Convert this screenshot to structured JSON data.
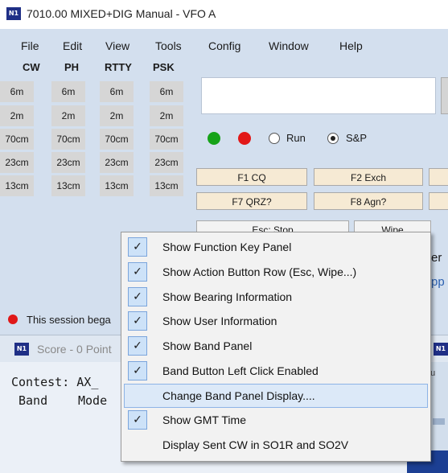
{
  "window": {
    "icon_text": "N1",
    "title": "7010.00 MIXED+DIG Manual - VFO A"
  },
  "menubar": [
    "File",
    "Edit",
    "View",
    "Tools",
    "Config",
    "Window",
    "Help"
  ],
  "modes": [
    "CW",
    "PH",
    "RTTY",
    "PSK"
  ],
  "bands": [
    "6m",
    "2m",
    "70cm",
    "23cm",
    "13cm"
  ],
  "status": {
    "led1_color": "#16a319",
    "led2_color": "#e21818",
    "run_label": "Run",
    "sp_label": "S&P",
    "selected": "S&P"
  },
  "function_keys": {
    "row1": [
      "F1 CQ",
      "F2 Exch"
    ],
    "row2": [
      "F7 QRZ?",
      "F8 Agn?"
    ],
    "row3": [
      "Esc: Stop",
      "Wipe"
    ]
  },
  "session_text": "This session bega",
  "fragments": {
    "er": "er",
    "pp": "pp"
  },
  "score_window": {
    "icon_text": "N1",
    "title": "Score - 0 Point",
    "contest_line": "Contest: AX_",
    "header_band": "Band",
    "header_mode": "Mode",
    "right_icon_text": "N1",
    "right_frag": "C",
    "setup_frag": "etu"
  },
  "context_menu": {
    "items": [
      {
        "label": "Show Function Key Panel",
        "checked": true
      },
      {
        "label": "Show Action Button Row (Esc, Wipe...)",
        "checked": true
      },
      {
        "label": "Show Bearing Information",
        "checked": true
      },
      {
        "label": "Show User Information",
        "checked": true
      },
      {
        "label": "Show Band Panel",
        "checked": true
      },
      {
        "label": "Band Button Left Click Enabled",
        "checked": true
      },
      {
        "label": "Change Band Panel Display....",
        "checked": false,
        "highlighted": true
      },
      {
        "label": "Show GMT Time",
        "checked": true
      },
      {
        "label": "Display Sent CW in SO1R and SO2V",
        "checked": false
      }
    ],
    "check_glyph": "✓"
  }
}
